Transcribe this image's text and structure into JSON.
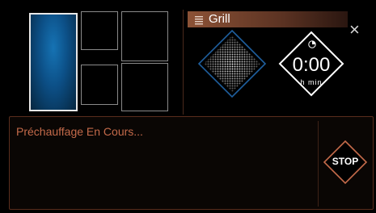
{
  "header": {
    "mode_label": "Grill",
    "mode_icon": "grill-icon",
    "close_icon": "close-icon"
  },
  "zones": {
    "selected_index": 0,
    "count": 5
  },
  "timer": {
    "value": "0:00",
    "units": "h  min",
    "icon": "clock-icon"
  },
  "status": {
    "message": "Préchauffage En Cours..."
  },
  "stop_button": {
    "label": "STOP"
  },
  "colors": {
    "accent": "#c46a4a",
    "header_bg": "#8c5236",
    "selected_zone": "#1673b4",
    "diamond_blue": "#1f5f9e"
  }
}
